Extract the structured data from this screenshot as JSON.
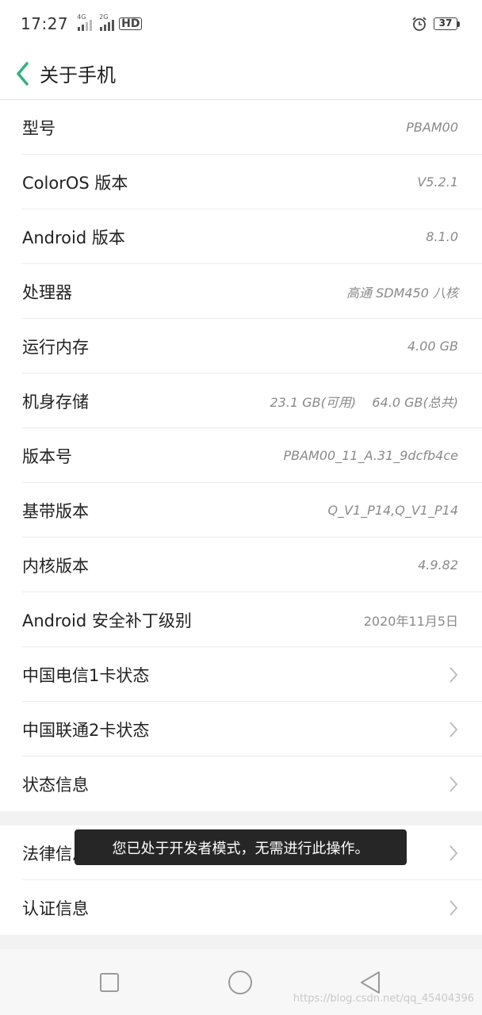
{
  "status_bar": {
    "time": "17:27",
    "sim1_network": "4G",
    "sim2_network": "2G",
    "hd_label": "HD",
    "battery_level": "37",
    "icons": [
      "alarm-icon",
      "battery-icon"
    ]
  },
  "header": {
    "title": "关于手机",
    "back_icon": "chevron-left-icon",
    "accent_color": "#2fb47c"
  },
  "items": [
    {
      "label": "型号",
      "value": "PBAM00"
    },
    {
      "label": "ColorOS 版本",
      "value": "V5.2.1"
    },
    {
      "label": "Android 版本",
      "value": "8.1.0"
    },
    {
      "label": "处理器",
      "value": "高通 SDM450 八核"
    },
    {
      "label": "运行内存",
      "value": "4.00 GB"
    },
    {
      "label": "机身存储",
      "value": "23.1 GB(可用)    64.0 GB(总共)"
    },
    {
      "label": "版本号",
      "value": "PBAM00_11_A.31_9dcfb4ce"
    },
    {
      "label": "基带版本",
      "value": "Q_V1_P14,Q_V1_P14"
    },
    {
      "label": "内核版本",
      "value": "4.9.82"
    },
    {
      "label": "Android 安全补丁级别",
      "value": "2020年11月5日"
    },
    {
      "label": "中国电信1卡状态",
      "value": ""
    },
    {
      "label": "中国联通2卡状态",
      "value": ""
    },
    {
      "label": "状态信息",
      "value": ""
    }
  ],
  "items_2": [
    {
      "label": "法律信息",
      "value": ""
    },
    {
      "label": "认证信息",
      "value": ""
    }
  ],
  "toast": {
    "message": "您已处于开发者模式，无需进行此操作。"
  },
  "nav_bar": {
    "icons": [
      "recent-apps-icon",
      "home-icon",
      "back-triangle-icon"
    ]
  },
  "watermark": "https://blog.csdn.net/qq_45404396"
}
